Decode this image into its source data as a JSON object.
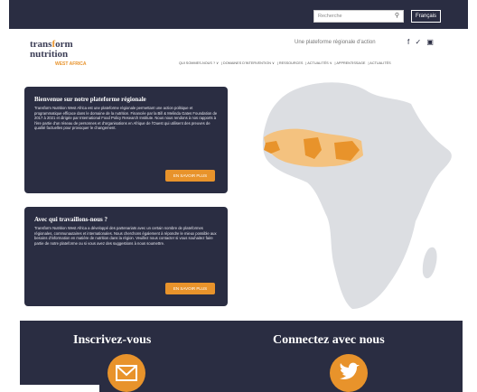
{
  "header": {
    "search_placeholder": "Recherche",
    "search_icon": "search-icon",
    "lang_button": "Français",
    "tagline": "Une plateforme régionale d'action",
    "social_icons": [
      "facebook-icon",
      "twitter-icon",
      "share-icon"
    ],
    "social_glyphs": "f ✓ ▣"
  },
  "logo": {
    "line1a": "trans",
    "line1b": "f",
    "line1c": "orm",
    "line2": "nutrition",
    "sub": "WEST AFRICA"
  },
  "nav": {
    "items": [
      "QUI SOMMES-NOUS ? ∨",
      "DOMAINES D'INTERVENTION ∨",
      "RESSOURCES",
      "ACTUALITÉS ∨",
      "APPRENTISSAGE",
      "ACTUALITÉS"
    ]
  },
  "card1": {
    "title": "Bienvenue sur notre plateforme régionale",
    "body": "Transform Nutrition West Africa est une plateforme régionale permettant une action politique et programmatique efficace dans le domaine de la nutrition. Financée par la Bill & Melinda Gates Foundation de 2017 à 2021 et dirigée par International Food Policy Research Institute. Nous nous rendons à nos rapports à l'ère partie d'un réseau de personnes et d'organisations en Afrique de l'Ouest qui utilisent des preuves de qualité factuelles pour provoquer le changement.",
    "button": "EN SAVOIR PLUS"
  },
  "card2": {
    "title": "Avec qui travaillons-nous ?",
    "body": "Transform Nutrition West Africa a développé des partenariats avec un certain nombre de plateformes régionales, communautaires et internationales. Nous cherchons également à répondre le mieux possible aux besoins d'information en matière de nutrition dans la région. Veuillez nous contacter si vous souhaitez faire partie de notre plateforme ou si vous avez des suggestions à nous soumettre.",
    "button": "EN SAVOIR PLUS"
  },
  "bottom": {
    "left_title": "Inscrivez-vous",
    "left_icon": "mail-icon",
    "right_title": "Connectez avec nous",
    "right_icon": "twitter-icon"
  },
  "colors": {
    "navy": "#2a2d42",
    "orange": "#e8932b",
    "map_gray": "#dcdee2",
    "map_light_orange": "#f4c27f"
  }
}
